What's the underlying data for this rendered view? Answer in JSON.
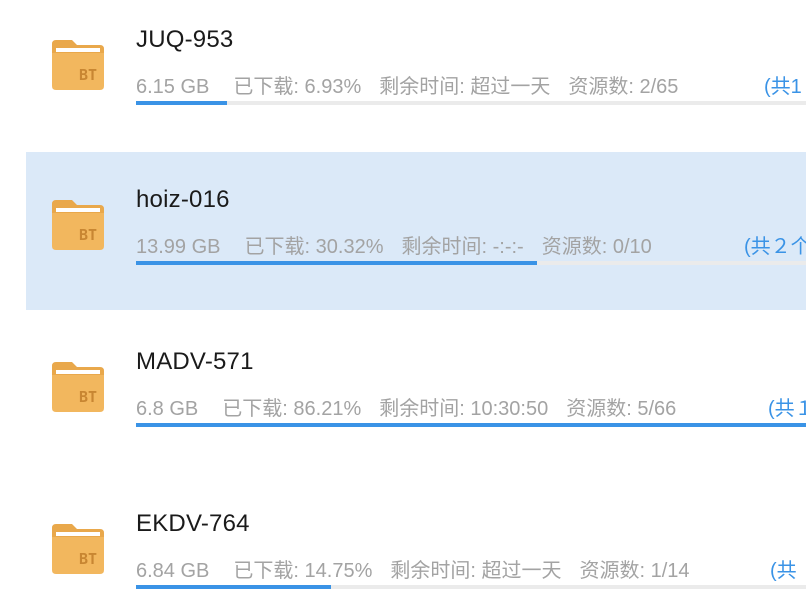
{
  "accent_color": "#3a93e6",
  "folder_color": "#f2b75e",
  "selected_bg": "#dbe9f8",
  "downloads": [
    {
      "name": "JUQ-953",
      "size": "6.15 GB",
      "downloaded_label": "已下载: ",
      "downloaded": "6.93%",
      "progress": 0.1307,
      "remaining_label": "剩余时间: ",
      "remaining": "超过一天",
      "resources_label": "资源数: ",
      "resources": "2/65",
      "total": "(共1",
      "selected": false,
      "icon": "bt-folder-icon",
      "icon_text": "BT"
    },
    {
      "name": "hoiz-016",
      "size": "13.99 GB",
      "downloaded_label": "已下载: ",
      "downloaded": "30.32%",
      "progress": 0.5729,
      "remaining_label": "剩余时间: ",
      "remaining": "-:-:-",
      "resources_label": "资源数: ",
      "resources": "0/10",
      "total": "(共２个",
      "selected": true,
      "icon": "bt-folder-icon",
      "icon_text": "BT"
    },
    {
      "name": "MADV-571",
      "size": "6.8 GB",
      "downloaded_label": "已下载: ",
      "downloaded": "86.21%",
      "progress": 1.0,
      "remaining_label": "剩余时间: ",
      "remaining": "10:30:50",
      "resources_label": "资源数: ",
      "resources": "5/66",
      "total": "(共１",
      "selected": false,
      "icon": "bt-folder-icon",
      "icon_text": "BT"
    },
    {
      "name": "EKDV-764",
      "size": "6.84 GB",
      "downloaded_label": "已下载: ",
      "downloaded": "14.75%",
      "progress": 0.2786,
      "remaining_label": "剩余时间: ",
      "remaining": "超过一天",
      "resources_label": "资源数: ",
      "resources": "1/14",
      "total": "(共",
      "selected": false,
      "icon": "bt-folder-icon",
      "icon_text": "BT"
    }
  ]
}
